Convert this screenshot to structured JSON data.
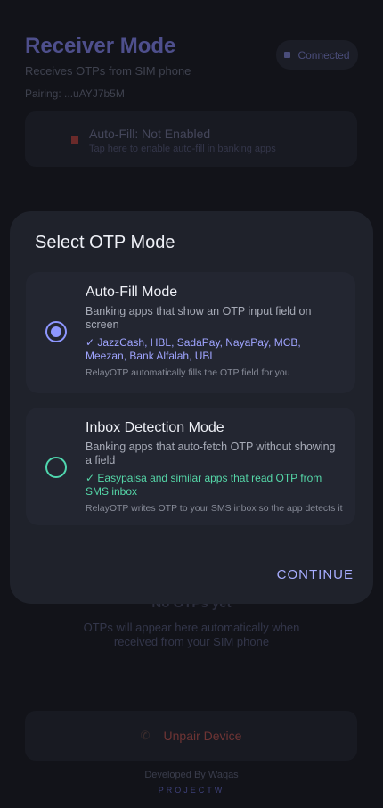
{
  "background": {
    "title": "Receiver Mode",
    "subtitle": "Receives OTPs from SIM phone",
    "pairing": "Pairing: ...uAYJ7b5M",
    "status_badge": "Connected",
    "autofill_title": "Auto-Fill: Not Enabled",
    "autofill_sub": "Tap here to enable auto-fill in banking apps",
    "empty_title": "No OTPs yet",
    "empty_sub": "OTPs will appear here automatically when received from your SIM phone",
    "unpair_label": "Unpair Device",
    "developed_by": "Developed By Waqas",
    "brand": "PROJECTW"
  },
  "dialog": {
    "title": "Select OTP Mode",
    "options": [
      {
        "title": "Auto-Fill Mode",
        "description": "Banking apps that show an OTP input field on screen",
        "apps": "✓ JazzCash, HBL, SadaPay, NayaPay, MCB, Meezan, Bank Alfalah, UBL",
        "note": "RelayOTP automatically fills the OTP field for you",
        "selected": true
      },
      {
        "title": "Inbox Detection Mode",
        "description": "Banking apps that auto-fetch OTP without showing a field",
        "apps": "✓ Easypaisa and similar apps that read OTP from SMS inbox",
        "note": "RelayOTP writes OTP to your SMS inbox so the app detects it",
        "selected": false
      }
    ],
    "continue_label": "CONTINUE"
  },
  "colors": {
    "accent": "#8e97ff",
    "green": "#4fd6ae",
    "danger": "#6e3434"
  }
}
